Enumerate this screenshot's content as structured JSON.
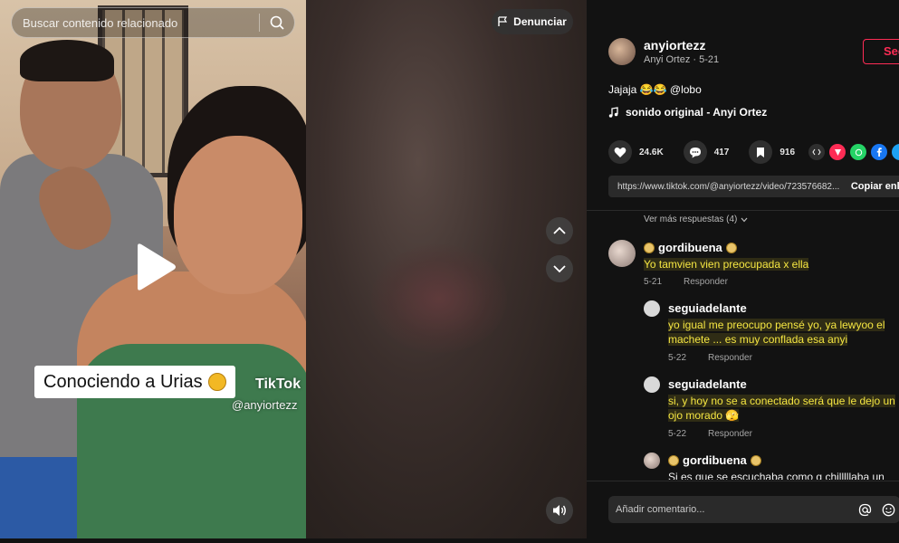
{
  "search": {
    "placeholder": "Buscar contenido relacionado"
  },
  "report": {
    "label": "Denunciar"
  },
  "video": {
    "caption": "Conociendo a Urias",
    "watermark_brand": "TikTok",
    "watermark_user": "@anyiortezz"
  },
  "author": {
    "username": "anyiortezz",
    "subtitle": "Anyi Ortez · 5-21",
    "follow_label": "Seguir"
  },
  "post": {
    "description": "Jajaja 😂😂 @lobo",
    "music": "sonido original - Anyi Ortez"
  },
  "actions": {
    "likes": "24.6K",
    "comments": "417",
    "saves": "916"
  },
  "share": {
    "link": "https://www.tiktok.com/@anyiortezz/video/723576682...",
    "copy_label": "Copiar enlace"
  },
  "comments": {
    "more_replies": "Ver más respuestas (4)",
    "items": [
      {
        "name": "gordibuena",
        "text": "Yo tamvien vien preocupada x ella",
        "date": "5-21",
        "reply": "Responder"
      },
      {
        "name": "seguiadelante",
        "text": "yo igual me preocupo pensé yo, ya lewyoo el machete ... es muy conflada esa anyi",
        "date": "5-22",
        "reply": "Responder"
      },
      {
        "name": "seguiadelante",
        "text": "si, y hoy no se a conectado será que le dejo un ojo morado 🫣",
        "date": "5-22",
        "reply": "Responder"
      },
      {
        "name": "gordibuena",
        "text": "Si es que se escuchaba como q chilllllaba un"
      }
    ]
  },
  "comment_input": {
    "placeholder": "Añadir comentario..."
  },
  "colors": {
    "accent": "#fe2c55",
    "background": "#121212",
    "highlight": "#f5e642"
  }
}
